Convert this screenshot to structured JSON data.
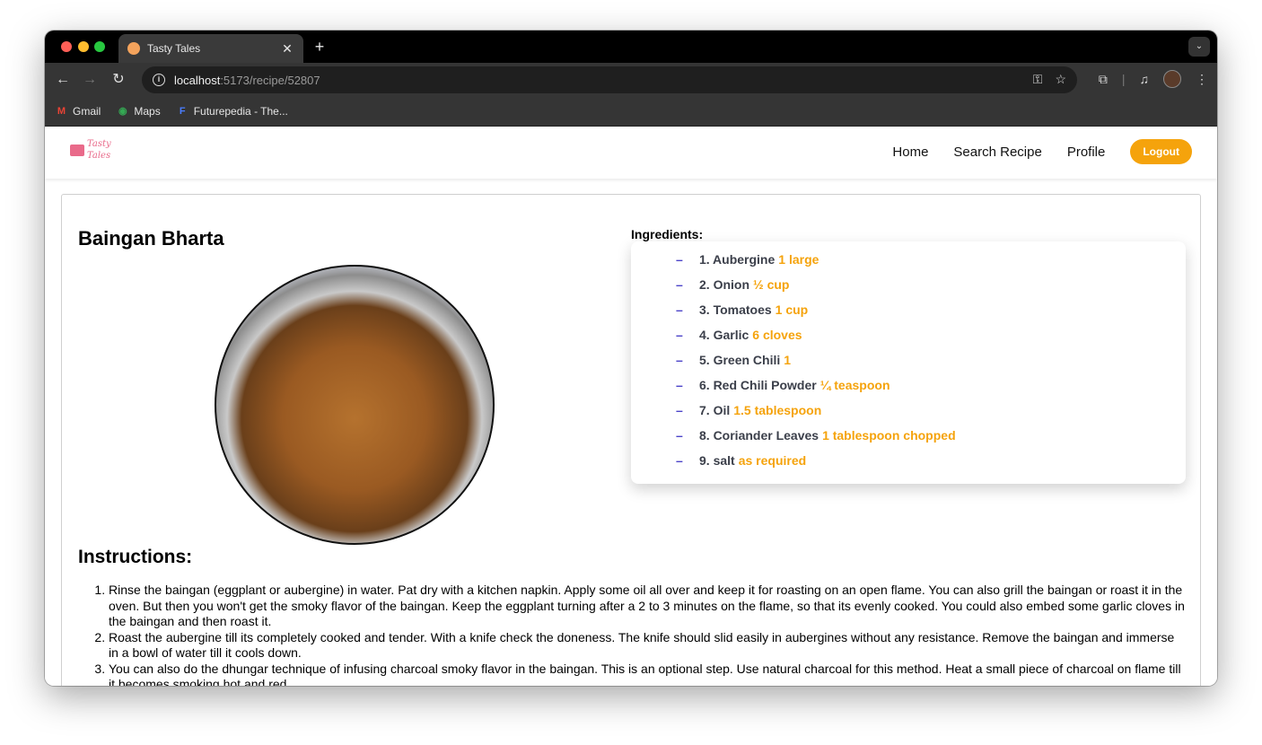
{
  "browser": {
    "tab_title": "Tasty Tales",
    "url_host": "localhost",
    "url_path": ":5173/recipe/52807",
    "bookmarks": [
      {
        "label": "Gmail",
        "icon": "gmail-icon"
      },
      {
        "label": "Maps",
        "icon": "maps-icon"
      },
      {
        "label": "Futurepedia - The...",
        "icon": "futurepedia-icon"
      }
    ]
  },
  "site": {
    "logo_text": "Tasty Tales",
    "nav": {
      "home": "Home",
      "search": "Search Recipe",
      "profile": "Profile",
      "logout": "Logout"
    }
  },
  "recipe": {
    "title": "Baingan Bharta",
    "ingredients_label": "Ingredients:",
    "ingredients": [
      {
        "name": "1. Aubergine",
        "qty": "1 large"
      },
      {
        "name": "2. Onion",
        "qty": "½ cup"
      },
      {
        "name": "3. Tomatoes",
        "qty": "1 cup"
      },
      {
        "name": "4. Garlic",
        "qty": "6 cloves"
      },
      {
        "name": "5. Green Chili",
        "qty": "1"
      },
      {
        "name": "6. Red Chili Powder",
        "qty": "¼ teaspoon"
      },
      {
        "name": "7. Oil",
        "qty": "1.5 tablespoon"
      },
      {
        "name": "8. Coriander Leaves",
        "qty": "1 tablespoon chopped"
      },
      {
        "name": "9. salt",
        "qty": "as required"
      }
    ],
    "instructions_label": "Instructions:",
    "instructions": [
      "Rinse the baingan (eggplant or aubergine) in water. Pat dry with a kitchen napkin. Apply some oil all over and keep it for roasting on an open flame. You can also grill the baingan or roast it in the oven. But then you won't get the smoky flavor of the baingan. Keep the eggplant turning after a 2 to 3 minutes on the flame, so that its evenly cooked. You could also embed some garlic cloves in the baingan and then roast it.",
      "Roast the aubergine till its completely cooked and tender. With a knife check the doneness. The knife should slid easily in aubergines without any resistance. Remove the baingan and immerse in a bowl of water till it cools down.",
      "You can also do the dhungar technique of infusing charcoal smoky flavor in the baingan. This is an optional step. Use natural charcoal for this method. Heat a small piece of charcoal on flame till it becomes smoking hot and red."
    ]
  },
  "colors": {
    "accent": "#f5a30c",
    "logo": "#e96a8a",
    "dash": "#4b44c9"
  }
}
